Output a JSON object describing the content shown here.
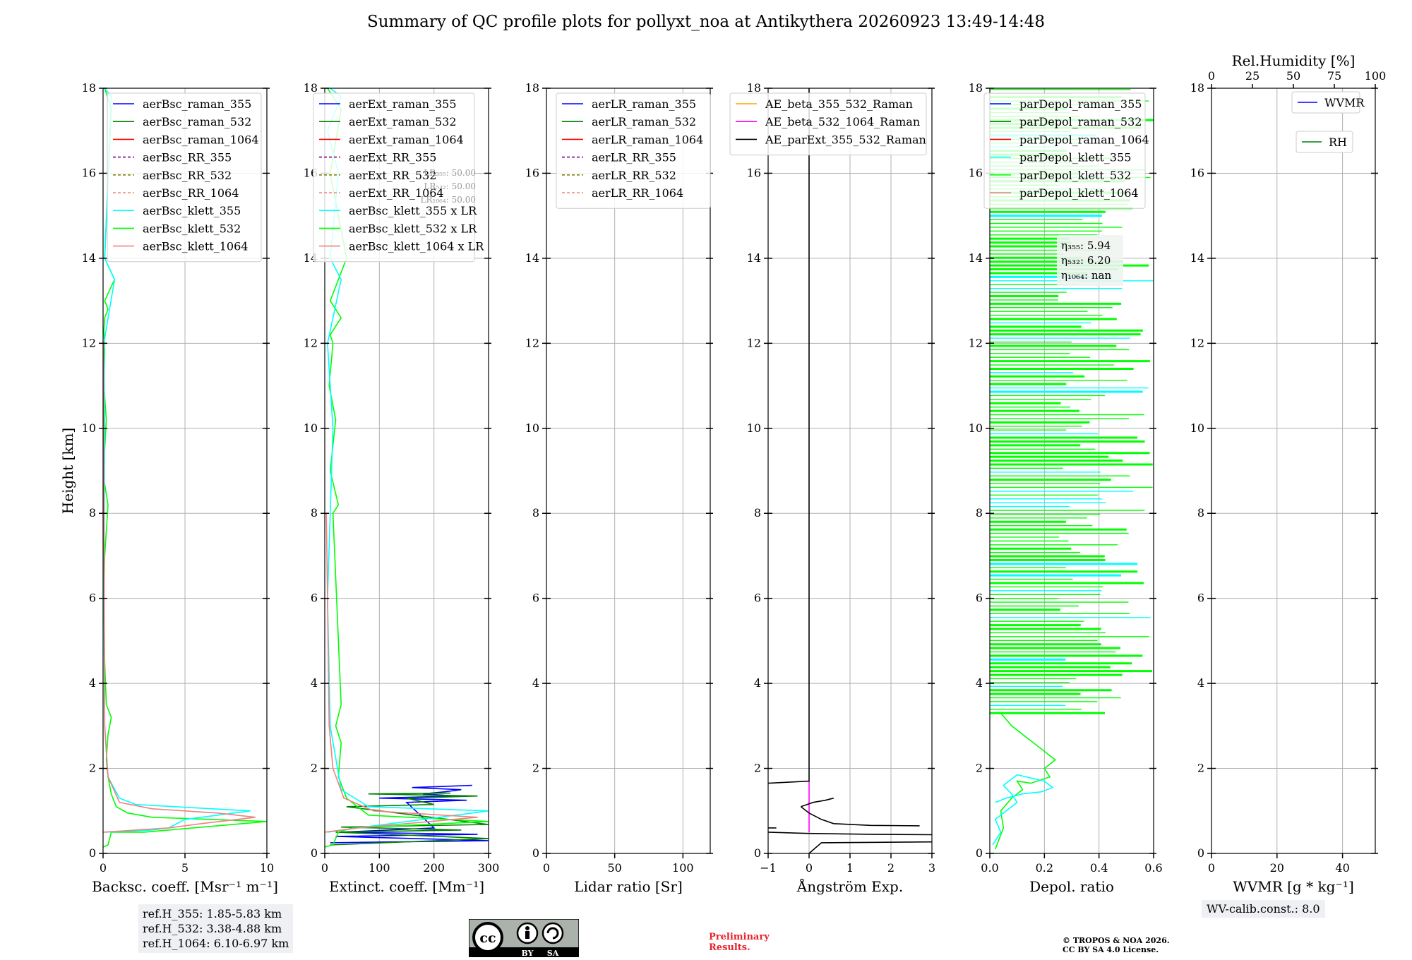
{
  "title": "Summary of QC profile plots for pollyxt_noa at Antikythera 20260923 13:49-14:48",
  "height_label": "Height [km]",
  "y_ticks": [
    "0",
    "2",
    "4",
    "6",
    "8",
    "10",
    "12",
    "14",
    "16",
    "18"
  ],
  "ref_heights": [
    "ref.H_355: 1.85-5.83 km",
    "ref.H_532: 3.38-4.88 km",
    "ref.H_1064: 6.10-6.97 km"
  ],
  "wv_calib": "WV-calib.const.: 8.0",
  "preliminary": [
    "Preliminary",
    "Results."
  ],
  "copyright": [
    "© TROPOS & NOA 2026.",
    "CC BY SA 4.0 License."
  ],
  "cc_badge": {
    "cc": "cc",
    "by": "BY",
    "sa": "SA"
  },
  "colors": {
    "blue": "#0000ff",
    "green": "#008000",
    "red": "#ff0000",
    "purple": "#800080",
    "olive": "#808000",
    "salmon": "#fa8072",
    "cyan": "#00ffff",
    "lime": "#00ff00",
    "lightcoral": "#f08080",
    "orange": "#ffa500",
    "magenta": "#ff00ff",
    "black": "#000000"
  },
  "chart_data": [
    {
      "type": "line",
      "xlabel": "Backsc. coeff. [Msr⁻¹ m⁻¹]",
      "xlim": [
        0,
        10
      ],
      "ylim": [
        0,
        18
      ],
      "x_ticks": [
        "0",
        "5",
        "10"
      ],
      "legend": [
        {
          "name": "aerBsc_raman_355",
          "color": "blue",
          "dash": false
        },
        {
          "name": "aerBsc_raman_532",
          "color": "green",
          "dash": false
        },
        {
          "name": "aerBsc_raman_1064",
          "color": "red",
          "dash": false
        },
        {
          "name": "aerBsc_RR_355",
          "color": "purple",
          "dash": true
        },
        {
          "name": "aerBsc_RR_532",
          "color": "olive",
          "dash": true
        },
        {
          "name": "aerBsc_RR_1064",
          "color": "salmon",
          "dash": true
        },
        {
          "name": "aerBsc_klett_355",
          "color": "cyan",
          "dash": false
        },
        {
          "name": "aerBsc_klett_532",
          "color": "lime",
          "dash": false
        },
        {
          "name": "aerBsc_klett_1064",
          "color": "lightcoral",
          "dash": false
        }
      ],
      "series": [
        {
          "color": "lime",
          "x": [
            0,
            0.3,
            0.5,
            2.5,
            4,
            10,
            3,
            1.5,
            0.8,
            0.5,
            0.3,
            0.2,
            0.3,
            0.5,
            0.2,
            0.1,
            0.05,
            0.1,
            0.3,
            0.05,
            0.1,
            0.2,
            0.05,
            0.1,
            0.05,
            0.1,
            0.3,
            0.1,
            0.7,
            0.1,
            0.5,
            0.1
          ],
          "y": [
            0.15,
            0.2,
            0.5,
            0.5,
            0.55,
            0.75,
            0.85,
            0.95,
            1.1,
            1.4,
            1.8,
            2.2,
            2.8,
            3.2,
            3.5,
            4.5,
            6,
            7,
            8.2,
            8.8,
            9.5,
            10.2,
            11,
            11.8,
            12.3,
            12.6,
            12.8,
            13,
            13.5,
            14,
            17.5,
            18
          ]
        },
        {
          "color": "cyan",
          "x": [
            0.1,
            3,
            4,
            5,
            9,
            2,
            1,
            0.3,
            0.1,
            0.05,
            0.1,
            0.05,
            0.7,
            0.1,
            0.5,
            0.1
          ],
          "y": [
            0.5,
            0.55,
            0.6,
            0.8,
            1.0,
            1.15,
            1.3,
            1.8,
            3,
            6,
            10,
            12,
            13.5,
            14,
            17.8,
            18
          ]
        },
        {
          "color": "lightcoral",
          "x": [
            0,
            2,
            4,
            6,
            9.3,
            7,
            3,
            1,
            0.3,
            0.1,
            0.05,
            0.02
          ],
          "y": [
            0.5,
            0.55,
            0.6,
            0.7,
            0.85,
            0.95,
            1.05,
            1.2,
            1.8,
            3,
            8,
            12
          ]
        }
      ]
    },
    {
      "type": "line",
      "xlabel": "Extinct. coeff. [Mm⁻¹]",
      "xlim": [
        0,
        300
      ],
      "ylim": [
        0,
        18
      ],
      "x_ticks": [
        "0",
        "100",
        "200",
        "300"
      ],
      "legend": [
        {
          "name": "aerExt_raman_355",
          "color": "blue",
          "dash": false
        },
        {
          "name": "aerExt_raman_532",
          "color": "green",
          "dash": false
        },
        {
          "name": "aerExt_raman_1064",
          "color": "red",
          "dash": false
        },
        {
          "name": "aerExt_RR_355",
          "color": "purple",
          "dash": true
        },
        {
          "name": "aerExt_RR_532",
          "color": "olive",
          "dash": true
        },
        {
          "name": "aerExt_RR_1064",
          "color": "salmon",
          "dash": true
        },
        {
          "name": "aerBsc_klett_355 x LR",
          "color": "cyan",
          "dash": false
        },
        {
          "name": "aerBsc_klett_532 x LR",
          "color": "lime",
          "dash": false
        },
        {
          "name": "aerBsc_klett_1064 x LR",
          "color": "lightcoral",
          "dash": false
        }
      ],
      "lr_labels": [
        "LR₃₅₅: 50.00",
        "LR₅₃₂: 50.00",
        "LR₁₀₆₄: 50.00"
      ],
      "series": [
        {
          "color": "blue",
          "x": [
            10,
            300,
            20,
            280,
            30,
            200,
            150,
            260,
            100,
            240,
            180,
            220,
            250,
            160,
            270
          ],
          "y": [
            0.25,
            0.3,
            0.4,
            0.45,
            0.5,
            0.6,
            1.2,
            1.25,
            1.3,
            1.35,
            1.4,
            1.45,
            1.5,
            1.55,
            1.6
          ]
        },
        {
          "color": "green",
          "x": [
            10,
            300,
            20,
            250,
            30,
            300,
            40,
            200,
            150,
            280,
            80,
            230
          ],
          "y": [
            0.2,
            0.35,
            0.5,
            0.55,
            0.62,
            0.68,
            1.1,
            1.15,
            1.3,
            1.35,
            1.4,
            1.42
          ]
        },
        {
          "color": "lime",
          "x": [
            0,
            15,
            25,
            50,
            300,
            80,
            40,
            25,
            30,
            20,
            30,
            15,
            25,
            10,
            20,
            8,
            15,
            10,
            30,
            10,
            40,
            10,
            30,
            5
          ],
          "y": [
            0.15,
            0.2,
            0.5,
            0.6,
            0.75,
            0.9,
            1.3,
            1.8,
            2.6,
            3,
            3.5,
            8,
            8.2,
            9,
            10.2,
            11,
            12,
            12.2,
            12.6,
            13,
            14,
            16,
            17.5,
            18
          ]
        },
        {
          "color": "cyan",
          "x": [
            5,
            60,
            300,
            80,
            30,
            10,
            5,
            15,
            5,
            30,
            10,
            25,
            5,
            30,
            10
          ],
          "y": [
            0.5,
            0.6,
            1.0,
            1.1,
            1.5,
            3,
            6,
            10,
            12,
            13.5,
            14,
            16,
            17,
            17.8,
            18
          ]
        },
        {
          "color": "lightcoral",
          "x": [
            0,
            60,
            280,
            90,
            35,
            15,
            8,
            3
          ],
          "y": [
            0.5,
            0.6,
            0.85,
            1.0,
            1.3,
            2,
            3,
            8
          ]
        }
      ]
    },
    {
      "type": "line",
      "xlabel": "Lidar ratio [Sr]",
      "xlim": [
        0,
        120
      ],
      "ylim": [
        0,
        18
      ],
      "x_ticks": [
        "0",
        "50",
        "100"
      ],
      "legend": [
        {
          "name": "aerLR_raman_355",
          "color": "blue",
          "dash": false
        },
        {
          "name": "aerLR_raman_532",
          "color": "green",
          "dash": false
        },
        {
          "name": "aerLR_raman_1064",
          "color": "red",
          "dash": false
        },
        {
          "name": "aerLR_RR_355",
          "color": "purple",
          "dash": true
        },
        {
          "name": "aerLR_RR_532",
          "color": "olive",
          "dash": true
        },
        {
          "name": "aerLR_RR_1064",
          "color": "salmon",
          "dash": true
        }
      ],
      "series": []
    },
    {
      "type": "line",
      "xlabel": "Ångström Exp.",
      "xlim": [
        -1,
        3
      ],
      "ylim": [
        0,
        18
      ],
      "x_ticks": [
        "−1",
        "0",
        "1",
        "2",
        "3"
      ],
      "legend": [
        {
          "name": "AE_beta_355_532_Raman",
          "color": "orange",
          "dash": false
        },
        {
          "name": "AE_beta_532_1064_Raman",
          "color": "magenta",
          "dash": false
        },
        {
          "name": "AE_parExt_355_532_Raman",
          "color": "black",
          "dash": false
        }
      ],
      "series": [
        {
          "color": "magenta",
          "x": [
            0,
            0
          ],
          "y": [
            0.5,
            1.7
          ]
        },
        {
          "color": "black",
          "x": [
            0,
            0,
            -1
          ],
          "y": [
            18,
            1.7,
            1.65
          ]
        },
        {
          "color": "black",
          "x": [
            -0.2,
            0.1,
            0.4,
            0.6
          ],
          "y": [
            1.1,
            1.2,
            1.25,
            1.3
          ]
        },
        {
          "color": "black",
          "x": [
            -0.2,
            0,
            0.3,
            0.6,
            1.5,
            2.7
          ],
          "y": [
            1.1,
            0.95,
            0.8,
            0.7,
            0.66,
            0.65
          ]
        },
        {
          "color": "black",
          "x": [
            -1,
            -0.8
          ],
          "y": [
            0.6,
            0.6
          ]
        },
        {
          "color": "black",
          "x": [
            -1,
            0,
            1.5,
            3
          ],
          "y": [
            0.5,
            0.47,
            0.45,
            0.44
          ]
        },
        {
          "color": "black",
          "x": [
            0,
            0.3,
            3
          ],
          "y": [
            0,
            0.25,
            0.27
          ]
        }
      ]
    },
    {
      "type": "line",
      "xlabel": "Depol. ratio",
      "xlim": [
        0,
        0.6
      ],
      "ylim": [
        0,
        18
      ],
      "x_ticks": [
        "0.0",
        "0.2",
        "0.4",
        "0.6"
      ],
      "legend": [
        {
          "name": "parDepol_raman_355",
          "color": "blue",
          "dash": false
        },
        {
          "name": "parDepol_raman_532",
          "color": "green",
          "dash": false
        },
        {
          "name": "parDepol_raman_1064",
          "color": "red",
          "dash": false
        },
        {
          "name": "parDepol_klett_355",
          "color": "cyan",
          "dash": false
        },
        {
          "name": "parDepol_klett_532",
          "color": "lime",
          "dash": false
        },
        {
          "name": "parDepol_klett_1064",
          "color": "lightcoral",
          "dash": false
        }
      ],
      "annotation": [
        "η₃₅₅: 5.94",
        "η₅₃₂: 6.20",
        "η₁₀₆₄: nan"
      ],
      "series": [
        {
          "color": "lime",
          "x": [
            0.02,
            0.05,
            0.04,
            0.08,
            0.12,
            0.1,
            0.15,
            0.22,
            0.2,
            0.24,
            0.16,
            0.08,
            0.04
          ],
          "y": [
            0.1,
            0.6,
            1.0,
            1.3,
            1.5,
            1.7,
            1.65,
            1.8,
            2.0,
            2.2,
            2.6,
            3.0,
            3.3
          ]
        },
        {
          "color": "cyan",
          "x": [
            0.01,
            0.04,
            0.02,
            0.06,
            0.1,
            0.08,
            0.05,
            0.1,
            0.2,
            0.23,
            0.19,
            0.12,
            0.06,
            0.02
          ],
          "y": [
            0.2,
            0.5,
            0.8,
            1.0,
            1.2,
            1.4,
            1.6,
            1.85,
            1.7,
            1.55,
            1.45,
            1.4,
            1.3,
            1.2
          ]
        }
      ]
    },
    {
      "type": "line",
      "xlabel": "WVMR [g * kg⁻¹]",
      "top_xlabel": "Rel.Humidity [%]",
      "xlim": [
        0,
        50
      ],
      "ylim": [
        0,
        18
      ],
      "x_ticks": [
        "0",
        "20",
        "40"
      ],
      "top_ticks": [
        "0",
        "25",
        "50",
        "75",
        "100"
      ],
      "legend": [
        {
          "name": "WVMR",
          "color": "blue",
          "dash": false
        },
        {
          "name": "RH",
          "color": "green",
          "dash": false
        }
      ],
      "series": []
    }
  ]
}
